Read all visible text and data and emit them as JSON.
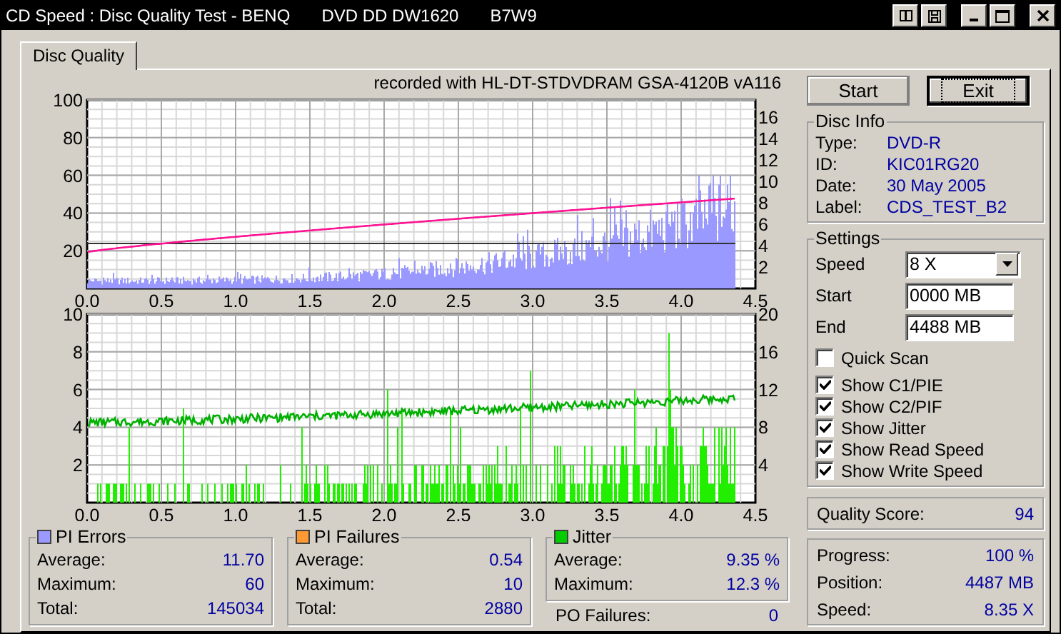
{
  "window": {
    "title_parts": [
      "CD Speed : Disc Quality Test - BENQ",
      "DVD DD DW1620",
      "B7W9"
    ]
  },
  "tabs": [
    {
      "label": "Disc Quality",
      "selected": true
    }
  ],
  "recorder_note": "recorded with HL-DT-STDVDRAM GSA-4120B vA116",
  "charts": [
    {
      "kind": "errors",
      "left_ticks": [
        "100",
        "80",
        "60",
        "40",
        "20"
      ],
      "right_ticks": [
        "16",
        "14",
        "12",
        "10",
        "8",
        "6",
        "4",
        "2"
      ],
      "x_ticks": [
        "0.0",
        "0.5",
        "1.0",
        "1.5",
        "2.0",
        "2.5",
        "3.0",
        "3.5",
        "4.0",
        "4.5"
      ]
    },
    {
      "kind": "failures",
      "left_ticks": [
        "10",
        "8",
        "6",
        "4",
        "2"
      ],
      "right_ticks": [
        "20",
        "16",
        "12",
        "8",
        "4"
      ],
      "x_ticks": [
        "0.0",
        "0.5",
        "1.0",
        "1.5",
        "2.0",
        "2.5",
        "3.0",
        "3.5",
        "4.0",
        "4.5"
      ]
    }
  ],
  "buttons": [
    {
      "label": "Start",
      "focused": false
    },
    {
      "label": "Exit",
      "focused": true
    }
  ],
  "disc_info": {
    "title": "Disc Info",
    "rows": [
      {
        "label": "Type:",
        "value": "DVD-R"
      },
      {
        "label": "ID:",
        "value": "KIC01RG20"
      },
      {
        "label": "Date:",
        "value": "30 May 2005"
      },
      {
        "label": "Label:",
        "value": "CDS_TEST_B2"
      }
    ]
  },
  "settings": {
    "title": "Settings",
    "fields": [
      {
        "kind": "dropdown",
        "label": "Speed",
        "value": "8 X"
      },
      {
        "kind": "text",
        "label": "Start",
        "value": "0000 MB"
      },
      {
        "kind": "text",
        "label": "End",
        "value": "4488 MB"
      }
    ],
    "options": [
      {
        "label": "Quick Scan",
        "checked": false
      },
      {
        "label": "Show C1/PIE",
        "checked": true
      },
      {
        "label": "Show C2/PIF",
        "checked": true
      },
      {
        "label": "Show Jitter",
        "checked": true
      },
      {
        "label": "Show Read Speed",
        "checked": true
      },
      {
        "label": "Show Write Speed",
        "checked": true
      }
    ]
  },
  "quality_score": {
    "label": "Quality Score:",
    "value": "94"
  },
  "progress": [
    {
      "label": "Progress:",
      "value": "100 %"
    },
    {
      "label": "Position:",
      "value": "4487 MB"
    },
    {
      "label": "Speed:",
      "value": "8.35 X"
    }
  ],
  "stats": [
    {
      "title": "PI Errors",
      "color": "#9999ff",
      "rows": [
        {
          "label": "Average:",
          "value": "11.70"
        },
        {
          "label": "Maximum:",
          "value": "60"
        },
        {
          "label": "Total:",
          "value": "145034"
        }
      ]
    },
    {
      "title": "PI Failures",
      "color": "#ff9933",
      "rows": [
        {
          "label": "Average:",
          "value": "0.54"
        },
        {
          "label": "Maximum:",
          "value": "10"
        },
        {
          "label": "Total:",
          "value": "2880"
        }
      ]
    },
    {
      "title": "Jitter",
      "color": "#00cc00",
      "rows": [
        {
          "label": "Average:",
          "value": "9.35 %"
        },
        {
          "label": "Maximum:",
          "value": "12.3 %"
        }
      ]
    }
  ],
  "po_failures": {
    "label": "PO Failures:",
    "value": "0"
  }
}
